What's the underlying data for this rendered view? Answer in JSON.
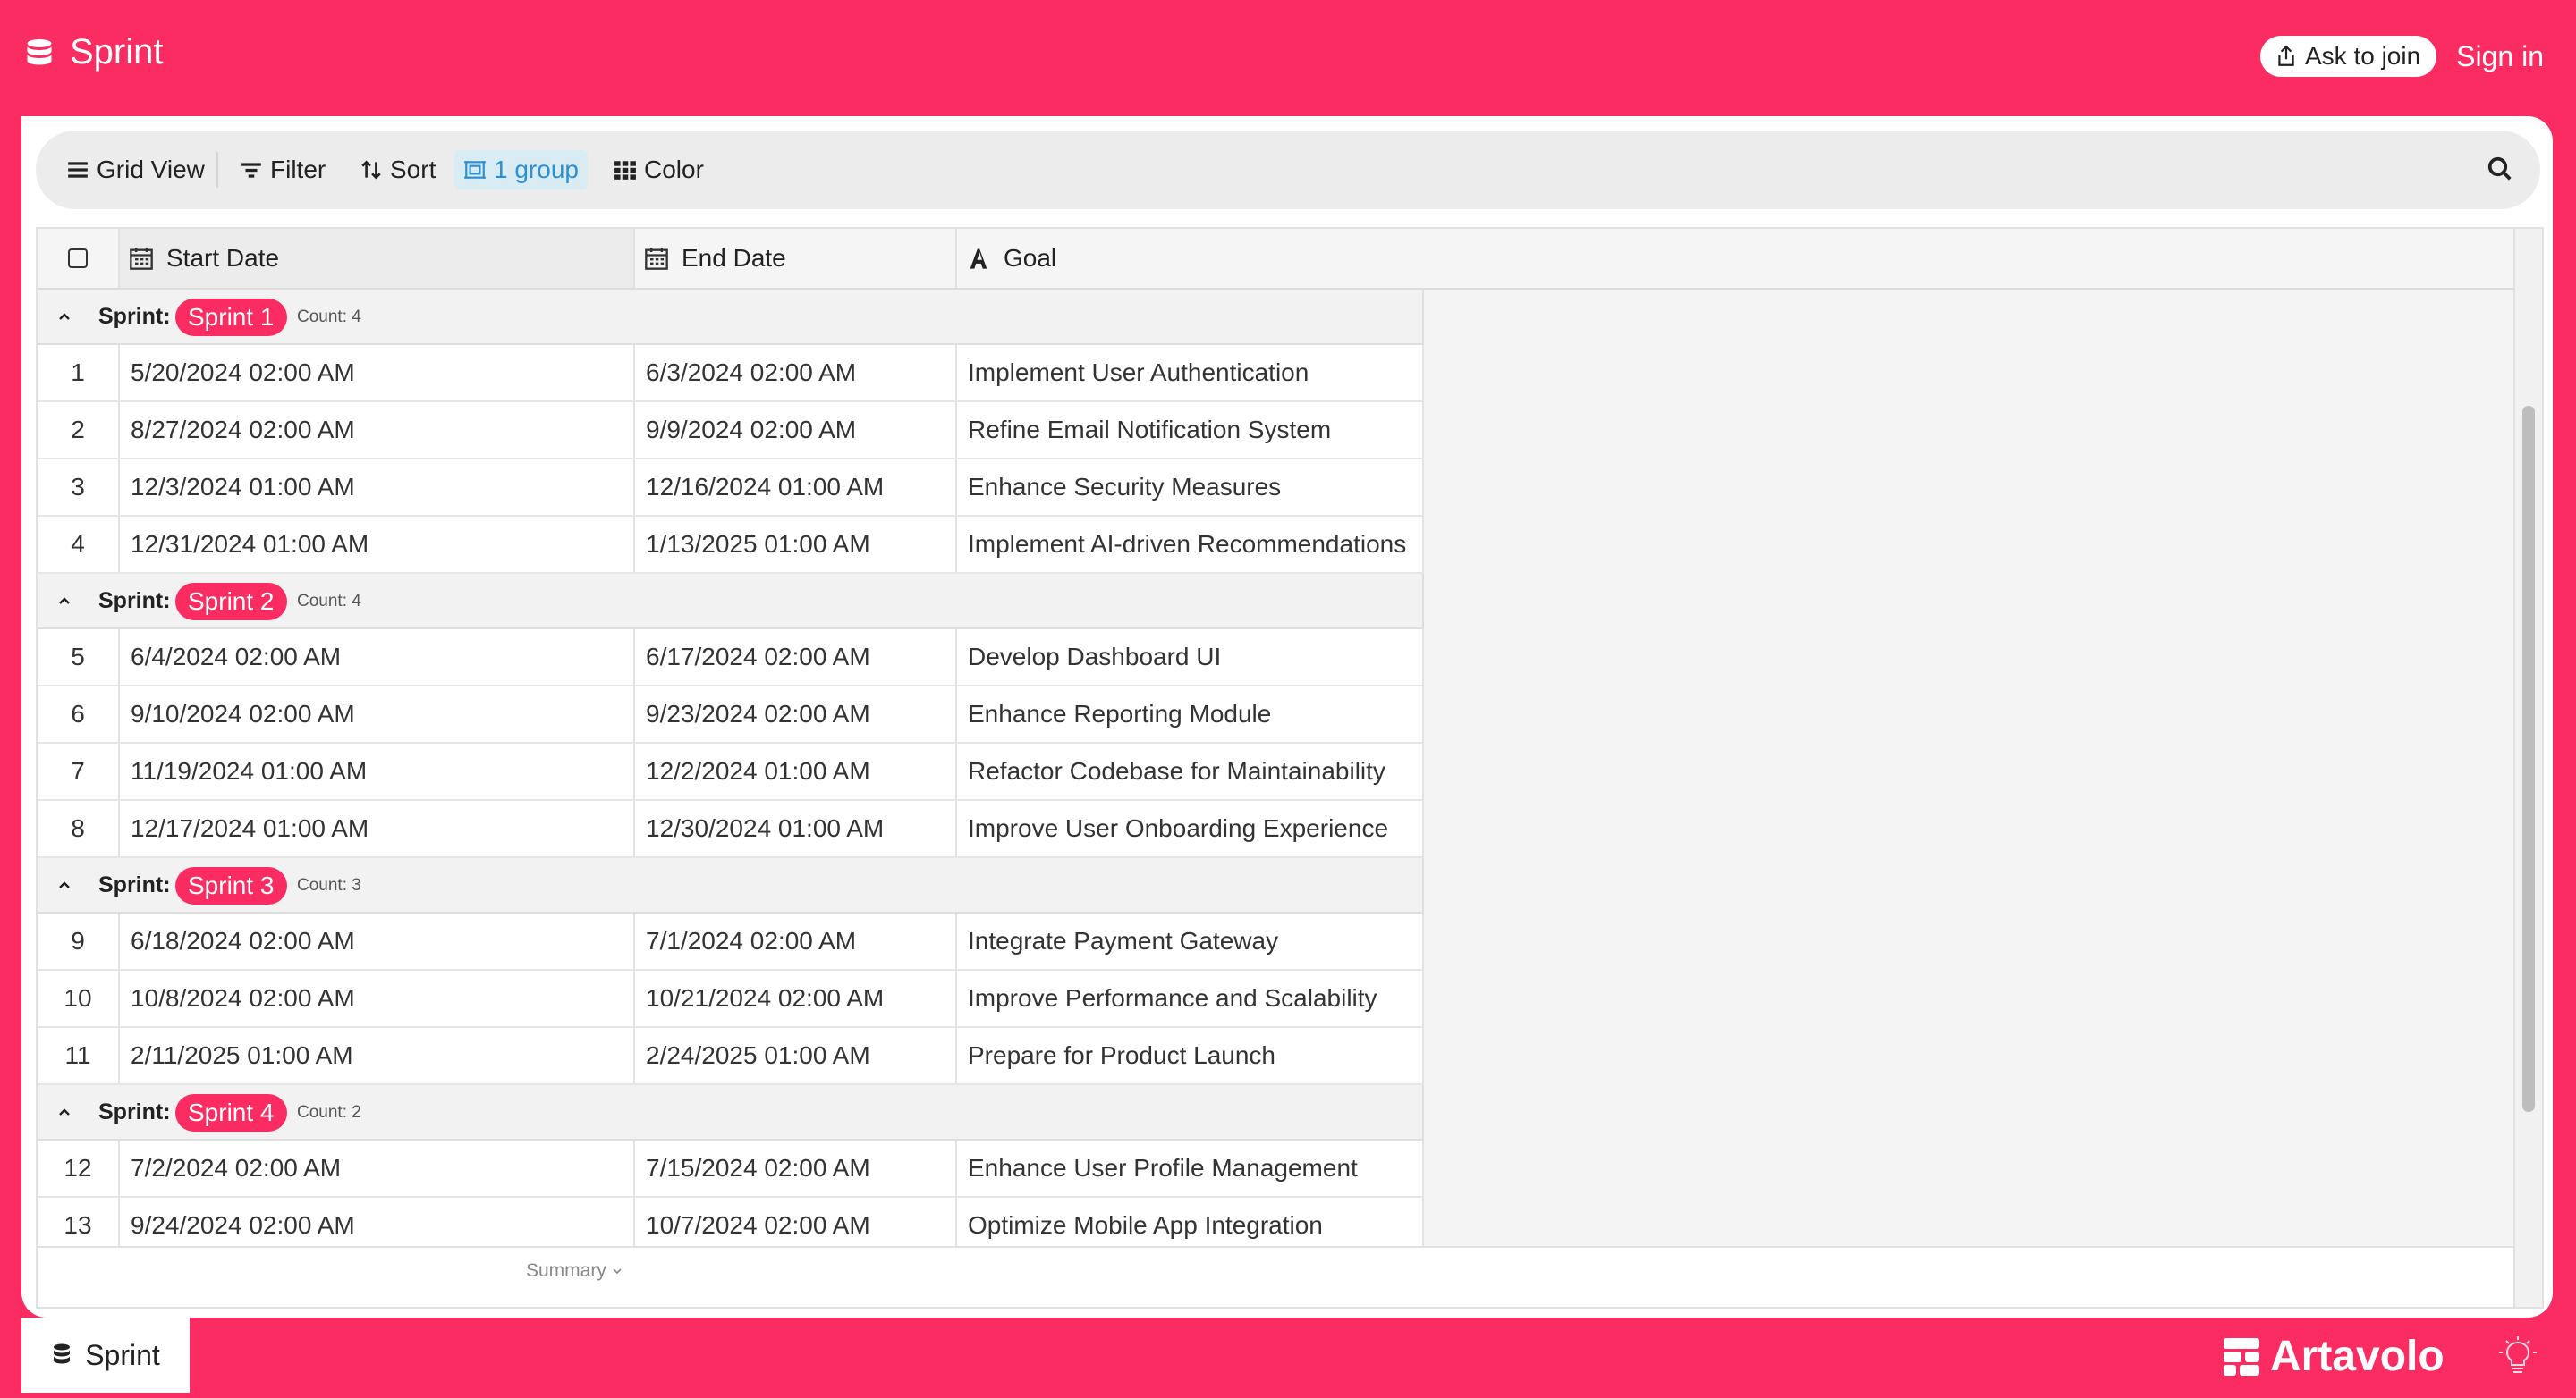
{
  "app": {
    "title": "Sprint"
  },
  "header": {
    "ask_join": "Ask to join",
    "sign_in": "Sign in"
  },
  "toolbar": {
    "grid_view": "Grid View",
    "filter": "Filter",
    "sort": "Sort",
    "group": "1 group",
    "color": "Color"
  },
  "columns": {
    "start": "Start Date",
    "end": "End Date",
    "goal": "Goal"
  },
  "groups": [
    {
      "label": "Sprint:",
      "name": "Sprint 1",
      "count": "Count: 4",
      "rows": [
        {
          "n": "1",
          "start": "5/20/2024 02:00 AM",
          "end": "6/3/2024 02:00 AM",
          "goal": "Implement User Authentication"
        },
        {
          "n": "2",
          "start": "8/27/2024 02:00 AM",
          "end": "9/9/2024 02:00 AM",
          "goal": "Refine Email Notification System"
        },
        {
          "n": "3",
          "start": "12/3/2024 01:00 AM",
          "end": "12/16/2024 01:00 AM",
          "goal": "Enhance Security Measures"
        },
        {
          "n": "4",
          "start": "12/31/2024 01:00 AM",
          "end": "1/13/2025 01:00 AM",
          "goal": "Implement AI-driven Recommendations"
        }
      ]
    },
    {
      "label": "Sprint:",
      "name": "Sprint 2",
      "count": "Count: 4",
      "rows": [
        {
          "n": "5",
          "start": "6/4/2024 02:00 AM",
          "end": "6/17/2024 02:00 AM",
          "goal": "Develop Dashboard UI"
        },
        {
          "n": "6",
          "start": "9/10/2024 02:00 AM",
          "end": "9/23/2024 02:00 AM",
          "goal": "Enhance Reporting Module"
        },
        {
          "n": "7",
          "start": "11/19/2024 01:00 AM",
          "end": "12/2/2024 01:00 AM",
          "goal": "Refactor Codebase for Maintainability"
        },
        {
          "n": "8",
          "start": "12/17/2024 01:00 AM",
          "end": "12/30/2024 01:00 AM",
          "goal": "Improve User Onboarding Experience"
        }
      ]
    },
    {
      "label": "Sprint:",
      "name": "Sprint 3",
      "count": "Count: 3",
      "rows": [
        {
          "n": "9",
          "start": "6/18/2024 02:00 AM",
          "end": "7/1/2024 02:00 AM",
          "goal": "Integrate Payment Gateway"
        },
        {
          "n": "10",
          "start": "10/8/2024 02:00 AM",
          "end": "10/21/2024 02:00 AM",
          "goal": "Improve Performance and Scalability"
        },
        {
          "n": "11",
          "start": "2/11/2025 01:00 AM",
          "end": "2/24/2025 01:00 AM",
          "goal": "Prepare for Product Launch"
        }
      ]
    },
    {
      "label": "Sprint:",
      "name": "Sprint 4",
      "count": "Count: 2",
      "rows": [
        {
          "n": "12",
          "start": "7/2/2024 02:00 AM",
          "end": "7/15/2024 02:00 AM",
          "goal": "Enhance User Profile Management"
        },
        {
          "n": "13",
          "start": "9/24/2024 02:00 AM",
          "end": "10/7/2024 02:00 AM",
          "goal": "Optimize Mobile App Integration"
        }
      ]
    }
  ],
  "summary": "Summary",
  "footer": {
    "tab": "Sprint",
    "logo": "Artavolo"
  },
  "colors": {
    "brand": "#fa2c61",
    "group_active": "#2b8fd6"
  }
}
